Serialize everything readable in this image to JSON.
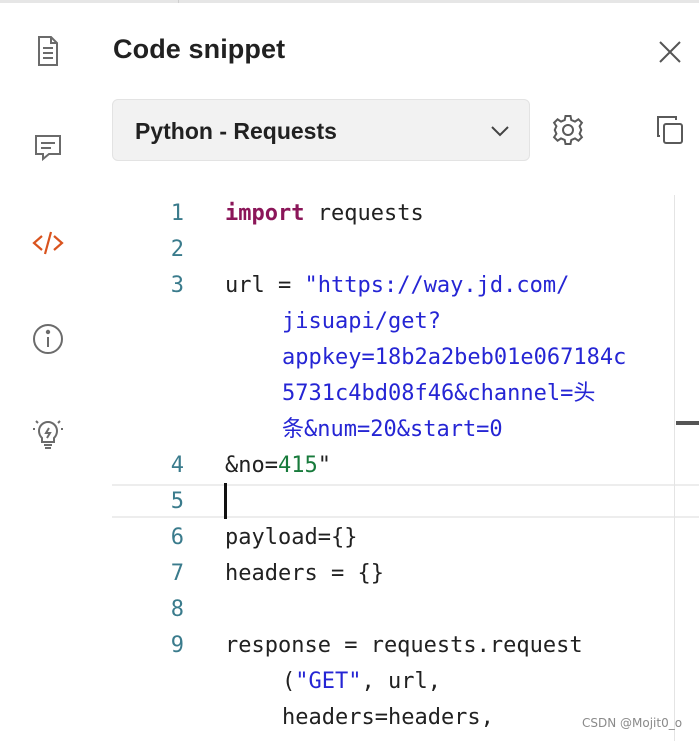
{
  "header": {
    "title": "Code snippet"
  },
  "toolbar": {
    "language": "Python - Requests"
  },
  "sidebar": {
    "items": [
      {
        "icon": "document-icon",
        "active": false
      },
      {
        "icon": "comment-icon",
        "active": false
      },
      {
        "icon": "code-icon",
        "active": true
      },
      {
        "icon": "info-icon",
        "active": false
      },
      {
        "icon": "lightbulb-icon",
        "active": false
      }
    ]
  },
  "code": {
    "lines": [
      {
        "number": "1",
        "segments": [
          {
            "kind": "kw",
            "text": "import"
          },
          {
            "kind": "plain",
            "text": " requests"
          }
        ]
      },
      {
        "number": "2",
        "segments": []
      },
      {
        "number": "3",
        "segments": [
          {
            "kind": "plain",
            "text": "url = "
          },
          {
            "kind": "str",
            "text": "\"https://way.jd.com/"
          }
        ]
      },
      {
        "number": "",
        "indent": true,
        "segments": [
          {
            "kind": "str",
            "text": "jisuapi/get?"
          }
        ]
      },
      {
        "number": "",
        "indent": true,
        "segments": [
          {
            "kind": "str",
            "text": "appkey=18b2a2beb01e067184c"
          }
        ]
      },
      {
        "number": "",
        "indent": true,
        "segments": [
          {
            "kind": "str",
            "text": "5731c4bd08f46&channel=头"
          }
        ]
      },
      {
        "number": "",
        "indent": true,
        "segments": [
          {
            "kind": "str",
            "text": "条&num=20&start=0"
          }
        ]
      },
      {
        "number": "4",
        "segments": [
          {
            "kind": "plain",
            "text": "&no="
          },
          {
            "kind": "num",
            "text": "415"
          },
          {
            "kind": "plain",
            "text": "\""
          }
        ]
      },
      {
        "number": "5",
        "segments": []
      },
      {
        "number": "6",
        "segments": [
          {
            "kind": "plain",
            "text": "payload={}"
          }
        ]
      },
      {
        "number": "7",
        "segments": [
          {
            "kind": "plain",
            "text": "headers = {}"
          }
        ]
      },
      {
        "number": "8",
        "segments": []
      },
      {
        "number": "9",
        "segments": [
          {
            "kind": "plain",
            "text": "response = requests.request"
          }
        ]
      },
      {
        "number": "",
        "indent": true,
        "segments": [
          {
            "kind": "plain",
            "text": "("
          },
          {
            "kind": "str",
            "text": "\"GET\""
          },
          {
            "kind": "plain",
            "text": ", url,"
          }
        ]
      },
      {
        "number": "",
        "indent": true,
        "segments": [
          {
            "kind": "plain",
            "text": "headers=headers,"
          }
        ]
      }
    ]
  },
  "footer": {
    "watermark": "CSDN @Mojit0_o"
  },
  "colors": {
    "keyword": "#8b1659",
    "string": "#2525d4",
    "number": "#177a3b",
    "line_number": "#3a7b8c",
    "active_icon": "#d9531e",
    "icon": "#6b6b6b"
  }
}
